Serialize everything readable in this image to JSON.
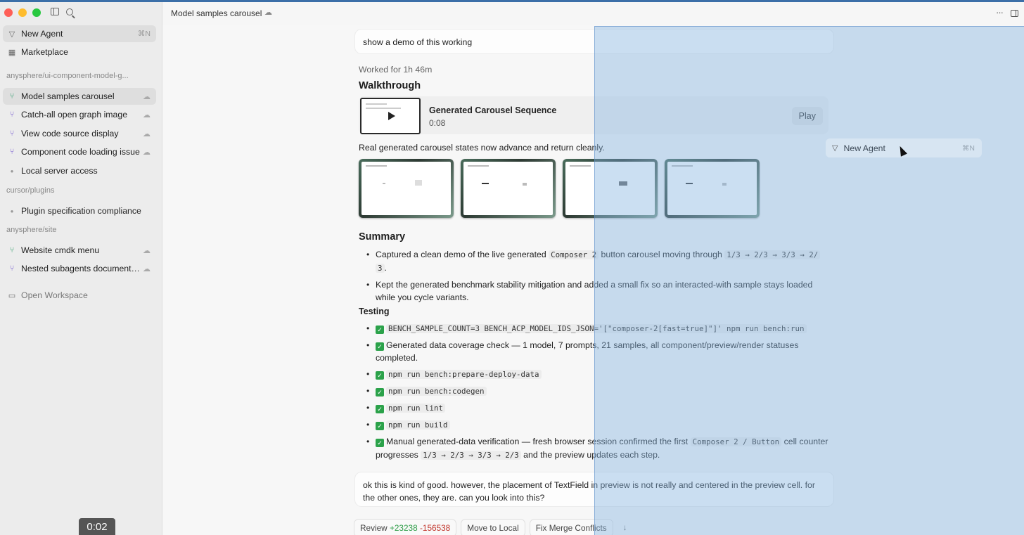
{
  "header": {
    "title": "Model samples carousel"
  },
  "sidebar": {
    "top_items": [
      {
        "label": "New Agent",
        "shortcut": "⌘N"
      },
      {
        "label": "Marketplace"
      }
    ],
    "sections": [
      {
        "title": "anysphere/ui-component-model-g..."
      },
      {
        "title": "cursor/plugins"
      },
      {
        "title": "anysphere/site"
      }
    ],
    "items": [
      {
        "label": "Model samples carousel"
      },
      {
        "label": "Catch-all open graph image"
      },
      {
        "label": "View code source display"
      },
      {
        "label": "Component code loading issue"
      },
      {
        "label": "Local server access"
      },
      {
        "label": "Plugin specification compliance"
      },
      {
        "label": "Website cmdk menu"
      },
      {
        "label": "Nested subagents documenta..."
      }
    ],
    "open_workspace": "Open Workspace"
  },
  "video_timestamp": "0:02",
  "chat": {
    "user_message_1": "show a demo of this working",
    "worked_for": "Worked for 1h 46m",
    "walkthrough_heading": "Walkthrough",
    "video": {
      "title": "Generated Carousel Sequence",
      "duration": "0:08",
      "play_label": "Play"
    },
    "real_text": "Real generated carousel states now advance and return cleanly.",
    "summary_heading": "Summary",
    "summary": {
      "item1_a": "Captured a clean demo of the live generated ",
      "item1_code1": "Composer 2",
      "item1_b": " button carousel moving through ",
      "item1_code2": "1/3 → 2/3 → 3/3 → 2/",
      "item1_code3": "3",
      "item1_c": ".",
      "item2": "Kept the generated benchmark stability mitigation and added a small fix so an interacted-with sample stays loaded while you cycle variants."
    },
    "testing_heading": "Testing",
    "testing": {
      "cmd1": "BENCH_SAMPLE_COUNT=3 BENCH_ACP_MODEL_IDS_JSON='[\"composer-2[fast=true]\"]' npm run bench:run",
      "item2": "Generated data coverage check — 1 model, 7 prompts, 21 samples, all component/preview/render statuses completed.",
      "cmd3": "npm run bench:prepare-deploy-data",
      "cmd4": "npm run bench:codegen",
      "cmd5": "npm run lint",
      "cmd6": "npm run build",
      "item7_a": "Manual generated-data verification — fresh browser session confirmed the first ",
      "item7_code1": "Composer 2 / Button",
      "item7_b": " cell counter progresses ",
      "item7_code2": "1/3 → 2/3 → 3/3 → 2/3",
      "item7_c": " and the preview updates each step."
    },
    "user_message_2": "ok this is kind of good. however, the placement of TextField in preview is not really and centered in the preview cell. for the other ones, they are. can you look into this?",
    "chips": {
      "review": "Review",
      "additions": "+23238",
      "deletions": "-156538",
      "move_local": "Move to Local",
      "fix_merge": "Fix Merge Conflicts",
      "down_arrow": "↓"
    }
  },
  "drag_item": {
    "label": "New Agent",
    "shortcut": "⌘N"
  }
}
